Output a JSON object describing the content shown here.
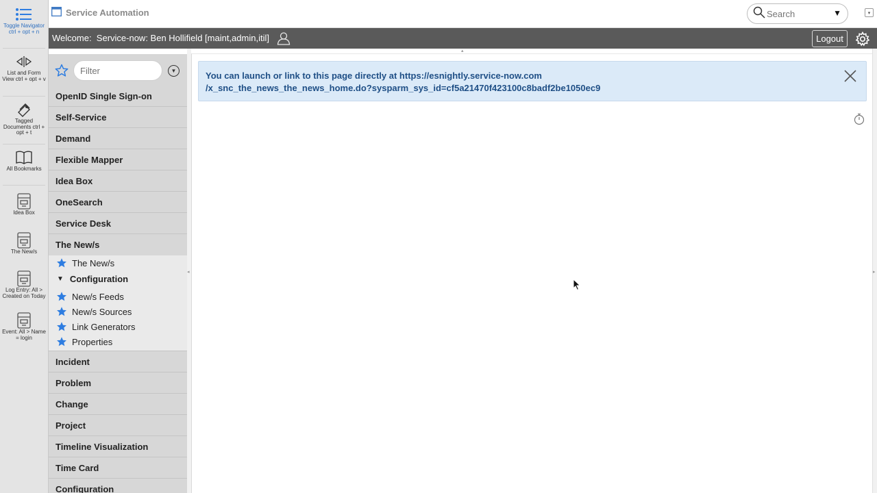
{
  "rail": {
    "items": [
      {
        "label": "Toggle Navigator ctrl + opt + n",
        "icon": "list-icon"
      },
      {
        "label": "List and Form View ctrl + opt + v",
        "icon": "split-view-icon"
      },
      {
        "label": "Tagged Documents ctrl + opt + t",
        "icon": "tag-icon"
      },
      {
        "label": "All Bookmarks",
        "icon": "book-icon"
      },
      {
        "label": "Idea Box",
        "icon": "form-icon"
      },
      {
        "label": "The New/s",
        "icon": "form-icon"
      },
      {
        "label": "Log Entry: All > Created on Today",
        "icon": "form-icon"
      },
      {
        "label": "Event: All > Name = login",
        "icon": "form-icon"
      }
    ]
  },
  "header": {
    "title": "Service Automation",
    "search_placeholder": "Search"
  },
  "welcome": {
    "label": "Welcome:",
    "user": "Service-now: Ben Hollifield [maint,admin,itil]",
    "logout": "Logout"
  },
  "nav": {
    "filter_placeholder": "Filter",
    "apps_before": [
      "OpenID Single Sign-on",
      "Self-Service",
      "Demand",
      "Flexible Mapper",
      "Idea Box",
      "OneSearch",
      "Service Desk"
    ],
    "open_app": "The New/s",
    "open_app_modules": [
      "The New/s"
    ],
    "section": "Configuration",
    "section_modules": [
      "New/s Feeds",
      "New/s Sources",
      "Link Generators",
      "Properties"
    ],
    "apps_after": [
      "Incident",
      "Problem",
      "Change",
      "Project",
      "Timeline Visualization",
      "Time Card",
      "Configuration"
    ]
  },
  "content": {
    "info_line1": "You can launch or link to this page directly at https://esnightly.service-now.com",
    "info_line2": "/x_snc_the_news_the_news_home.do?sysparm_sys_id=cf5a21470f423100c8badf2be1050ec9"
  },
  "colors": {
    "accent": "#2e7de1",
    "info_bg": "#dbeaf8",
    "info_text": "#1f4f86",
    "welcome_bar": "#5a5a5a"
  }
}
